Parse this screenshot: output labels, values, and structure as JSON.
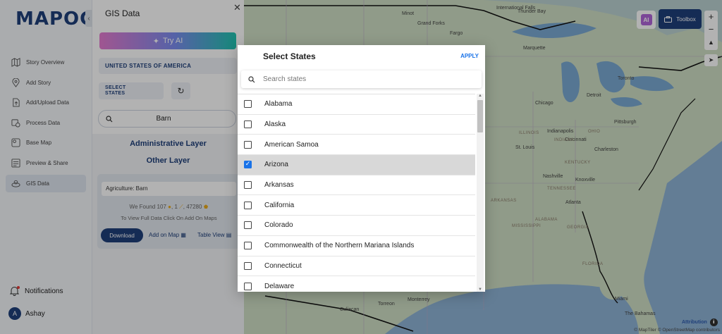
{
  "app": {
    "logo_text": "MAPOG"
  },
  "sidebar": {
    "items": [
      {
        "label": "Story Overview",
        "icon": "map-icon"
      },
      {
        "label": "Add Story",
        "icon": "location-pin-icon"
      },
      {
        "label": "Add/Upload Data",
        "icon": "upload-icon"
      },
      {
        "label": "Process Data",
        "icon": "process-icon"
      },
      {
        "label": "Base Map",
        "icon": "base-map-icon"
      },
      {
        "label": "Preview & Share",
        "icon": "preview-icon"
      },
      {
        "label": "GIS Data",
        "icon": "gis-data-icon",
        "active": true
      }
    ],
    "notifications_label": "Notifications",
    "user_name": "Ashay",
    "user_initial": "A"
  },
  "gis_panel": {
    "title": "GIS Data",
    "try_ai_label": "Try AI",
    "country_label": "UNITED STATES OF AMERICA",
    "select_states_line1": "SELECT",
    "select_states_line2": "STATES",
    "search_value": "Barn",
    "admin_layer_label": "Administrative Layer",
    "other_layer_label": "Other Layer",
    "result": {
      "name": "Agriculture: Barn",
      "found_prefix": "We Found",
      "count_points": "107",
      "count_lines": "1",
      "count_polygons": "47280",
      "hint": "To View Full Data Click On Add On Maps",
      "download_label": "Download",
      "add_on_map_label": "Add on Map",
      "table_view_label": "Table View"
    }
  },
  "map": {
    "toolbox_label": "Toolbox",
    "ai_badge": "AI",
    "zoom_in": "+",
    "zoom_out": "−",
    "attribution_label": "Attribution",
    "credits": "© MapTiler © OpenStreetMap contributors",
    "labels": [
      "International Falls",
      "Thunder Bay",
      "Minot",
      "Grand Forks",
      "Fargo",
      "Marquette",
      "Toronto",
      "Chicago",
      "Detroit",
      "Indianapolis",
      "Cincinnati",
      "Pittsburgh",
      "St. Louis",
      "Charleston",
      "Nashville",
      "Knoxville",
      "Atlanta",
      "Culiacan",
      "Torreon",
      "Monterrey",
      "Miami",
      "The Bahamas",
      "ILLINOIS",
      "KENTUCKY",
      "TENNESSEE",
      "ALABAMA",
      "GEORGIA",
      "FLORIDA",
      "OHIO",
      "INDIANA",
      "ARKANSAS",
      "MISSISSIPPI"
    ]
  },
  "modal": {
    "title": "Select States",
    "apply_label": "APPLY",
    "search_placeholder": "Search states",
    "states": [
      {
        "name": "Alabama",
        "checked": false
      },
      {
        "name": "Alaska",
        "checked": false
      },
      {
        "name": "American Samoa",
        "checked": false
      },
      {
        "name": "Arizona",
        "checked": true
      },
      {
        "name": "Arkansas",
        "checked": false
      },
      {
        "name": "California",
        "checked": false
      },
      {
        "name": "Colorado",
        "checked": false
      },
      {
        "name": "Commonwealth of the Northern Mariana Islands",
        "checked": false
      },
      {
        "name": "Connecticut",
        "checked": false
      },
      {
        "name": "Delaware",
        "checked": false
      }
    ]
  }
}
